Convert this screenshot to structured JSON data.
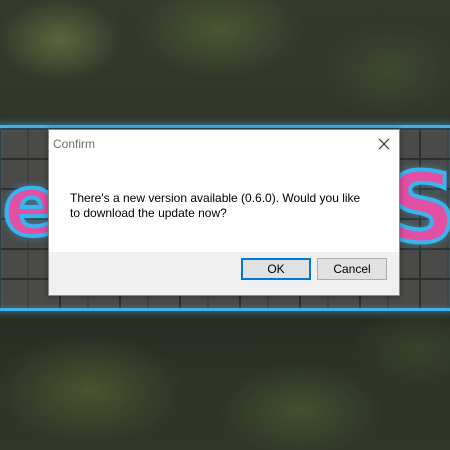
{
  "dialog": {
    "title": "Confirm",
    "message": "There's a new version available (0.6.0). Would you like to download the update now?",
    "ok_label": "OK",
    "cancel_label": "Cancel",
    "close_icon": "close-icon",
    "accent_color": "#0078d7"
  },
  "background": {
    "banner_border_color": "#3fb2e6",
    "neon_letters": [
      "e",
      "S"
    ]
  }
}
